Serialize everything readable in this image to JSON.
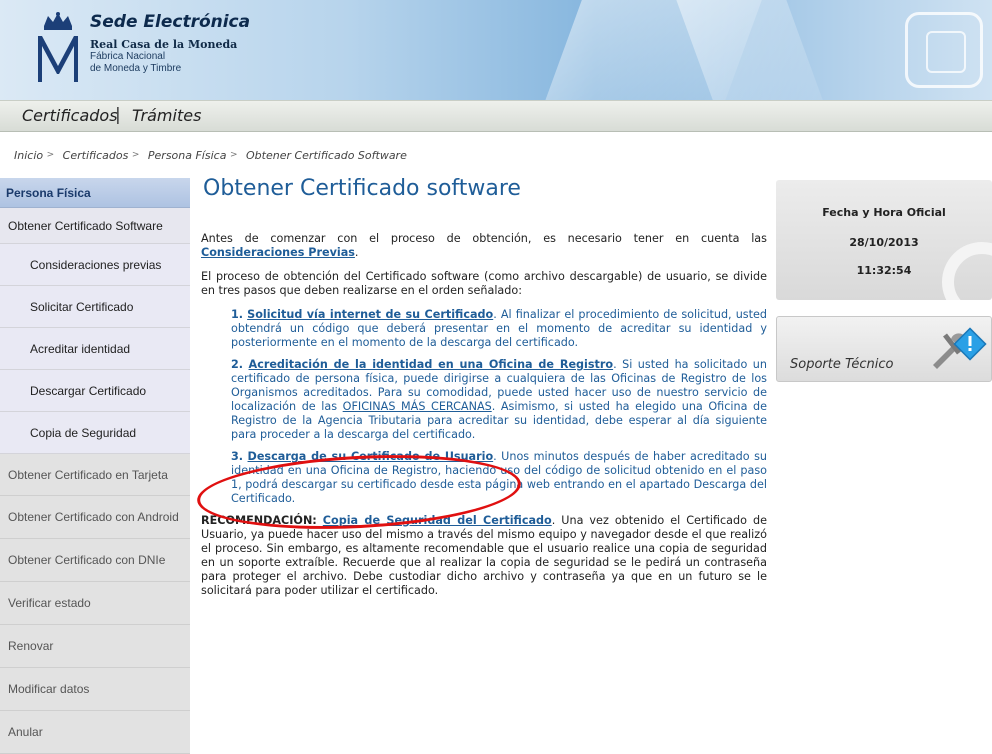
{
  "header": {
    "title": "Sede Electrónica",
    "org_line1": "Real Casa de la Moneda",
    "org_line2": "Fábrica Nacional",
    "org_line3": "de Moneda y Timbre"
  },
  "nav": {
    "items": [
      "Certificados",
      "Trámites"
    ],
    "separator": "|"
  },
  "breadcrumb": {
    "items": [
      "Inicio",
      "Certificados",
      "Persona Física",
      "Obtener Certificado Software"
    ]
  },
  "sidebar": {
    "header": "Persona Física",
    "items": [
      {
        "label": "Obtener Certificado Software"
      },
      {
        "label": "Consideraciones previas"
      },
      {
        "label": "Solicitar Certificado"
      },
      {
        "label": "Acreditar identidad"
      },
      {
        "label": "Descargar Certificado"
      },
      {
        "label": "Copia de Seguridad"
      },
      {
        "label": "Obtener Certificado en Tarjeta"
      },
      {
        "label": "Obtener Certificado con Android"
      },
      {
        "label": "Obtener Certificado con DNIe"
      },
      {
        "label": "Verificar estado"
      },
      {
        "label": "Renovar"
      },
      {
        "label": "Modificar datos"
      },
      {
        "label": "Anular"
      }
    ]
  },
  "main": {
    "title": "Obtener Certificado software",
    "intro_text": "Antes de comenzar con el proceso de obtención, es necesario tener en cuenta las",
    "intro_link": "Consideraciones Previas",
    "intro_end": ".",
    "process_text": "El proceso de obtención del Certificado software (como archivo descargable) de usuario, se divide en tres pasos que deben realizarse en el orden señalado:",
    "steps": [
      {
        "num": "1.",
        "link": "Solicitud vía internet de su Certificado",
        "text": ". Al finalizar el procedimiento de solicitud, usted obtendrá un código que deberá presentar en el momento de acreditar su identidad y posteriormente en el momento de la descarga del certificado."
      },
      {
        "num": "2.",
        "link": "Acreditación de la identidad en una Oficina de Registro",
        "text_a": ". Si usted ha solicitado un certificado de persona física, puede dirigirse a cualquiera de las Oficinas de Registro de los Organismos acreditados. Para su comodidad, puede usted hacer uso de nuestro servicio de localización de las ",
        "inner_link": "OFICINAS MÁS CERCANAS",
        "text_b": ". Asimismo, si usted ha elegido una Oficina de Registro de la Agencia Tributaria para acreditar su identidad, debe esperar al día siguiente para proceder a la descarga del certificado."
      },
      {
        "num": "3.",
        "link": "Descarga de su Certificado de Usuario",
        "text": ". Unos minutos después de haber acreditado su identidad en una Oficina de Registro, haciendo uso del código de solicitud obtenido en el paso 1, podrá descargar su certificado desde esta página web entrando en el apartado Descarga del Certificado."
      }
    ],
    "recommendation_label": "RECOMENDACIÓN:",
    "recommendation_link": "Copia de Seguridad del Certificado",
    "recommendation_text": ". Una vez obtenido el Certificado de Usuario, ya puede hacer uso del mismo a través del mismo equipo y navegador desde el que realizó el proceso. Sin embargo, es altamente recomendable que el usuario realice una copia de seguridad en un soporte extraíble. Recuerde que al realizar la copia de seguridad se le pedirá un contraseña para proteger el archivo. Debe custodiar dicho archivo y contraseña ya que en un futuro se le solicitará para poder utilizar el certificado."
  },
  "clock": {
    "label": "Fecha y Hora Oficial",
    "date": "28/10/2013",
    "time": "11:32:54"
  },
  "support": {
    "label": "Soporte Técnico"
  },
  "colors": {
    "link": "#1f5d98",
    "annotation": "#e01010"
  }
}
